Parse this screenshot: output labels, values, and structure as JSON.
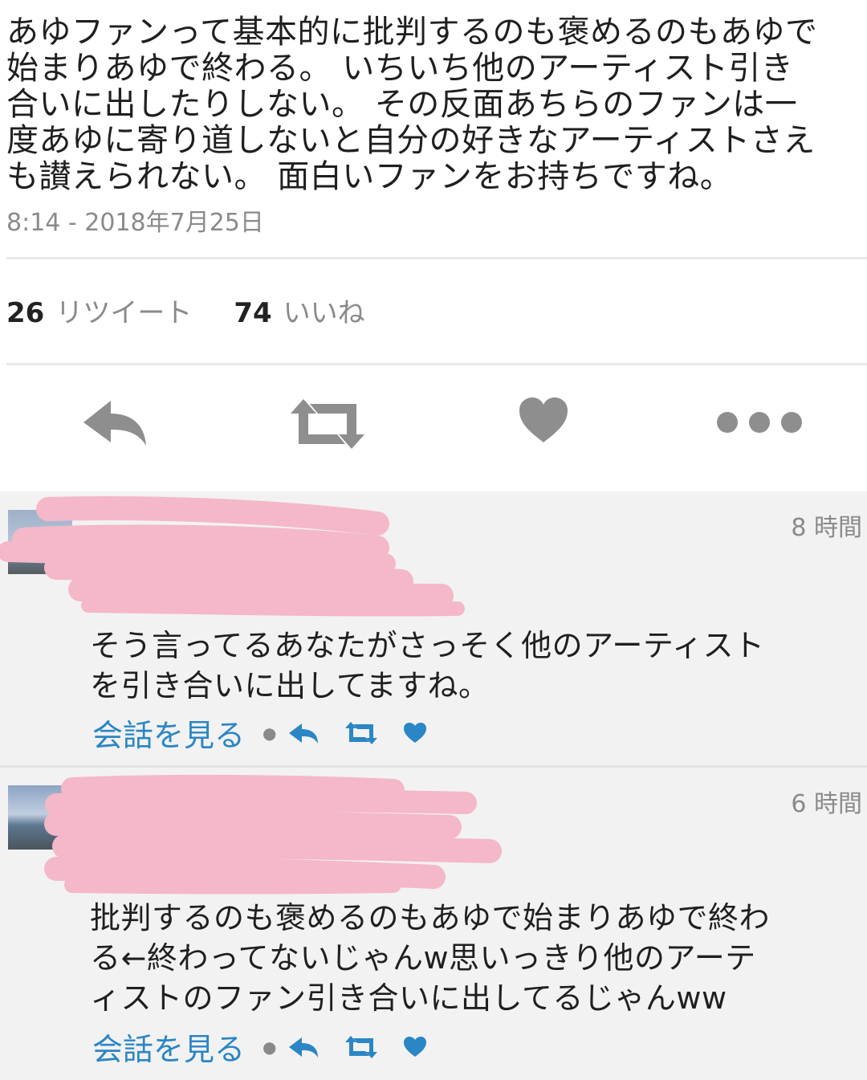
{
  "tweet": {
    "text": "あゆファンって基本的に批判するのも褒めるのもあゆで\n始まりあゆで終わる。 いちいち他のアーティスト引き\n合いに出したりしない。 その反面あちらのファンは一\n度あゆに寄り道しないと自分の好きなアーティストさえ\nも讃えられない。 面白いファンをお持ちですね。",
    "timestamp": "8:14 - 2018年7月25日",
    "retweet_count": "26",
    "retweet_label": "リツイート",
    "like_count": "74",
    "like_label": "いいね"
  },
  "actions": {
    "icons": [
      "reply-icon",
      "retweet-icon",
      "heart-icon",
      "more-icon"
    ],
    "icon_color": "#8e8e8e"
  },
  "replies": [
    {
      "time": "8 時間",
      "text": "そう言ってるあなたがさっそく他のアーティスト\nを引き合いに出してますね。",
      "view_conversation": "会話を見る"
    },
    {
      "time": "6 時間",
      "text": "批判するのも褒めるのもあゆで始まりあゆで終わ\nる←終わってないじゃんw思いっきり他のアーテ\nィストのファン引き合いに出してるじゃんww",
      "view_conversation": "会話を見る"
    }
  ],
  "colors": {
    "link": "#2b86c5",
    "redaction": "#f4b8c8",
    "muted": "#8a8a8a"
  }
}
